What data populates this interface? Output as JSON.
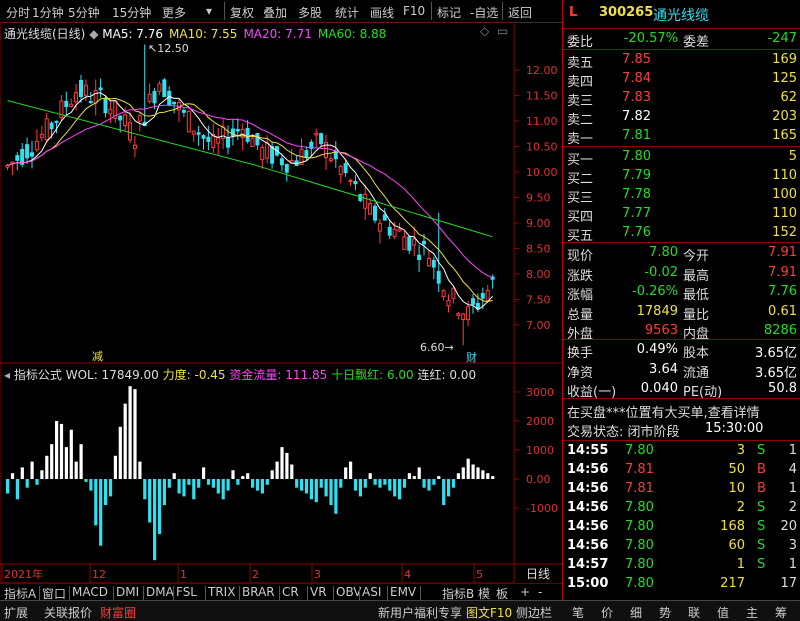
{
  "toolbar": {
    "items": [
      "分时",
      "1分钟",
      "5分钟",
      "15分钟",
      "更多",
      "复权",
      "叠加",
      "多股",
      "统计",
      "画线",
      "F10",
      "标记",
      "-自选",
      "返回"
    ]
  },
  "chart": {
    "title": "通光线缆(日线)",
    "ma": [
      {
        "label": "MA5: 7.76",
        "color": "#ffffff"
      },
      {
        "label": "MA10: 7.55",
        "color": "#f0e040"
      },
      {
        "label": "MA20: 7.71",
        "color": "#ff44ff"
      },
      {
        "label": "MA60: 8.88",
        "color": "#22dd22"
      }
    ],
    "price_ticks": [
      "12.00",
      "11.50",
      "11.00",
      "10.50",
      "10.00",
      "9.50",
      "9.00",
      "8.50",
      "8.00",
      "7.50",
      "7.00"
    ],
    "high_label": "12.50",
    "low_label": "6.60",
    "marker_jian": "减",
    "marker_cai": "财",
    "indicator": {
      "name": "指标公式",
      "wol": "WOL: 17849.00",
      "lidu": "力度: -0.45",
      "zjll": "资金流量: 111.85",
      "sr": "十日飘红: 6.00",
      "lh": "连红: 0.00"
    },
    "vol_ticks": [
      "3000",
      "2000",
      "1000",
      "0.00",
      "-1000"
    ],
    "date_labels": [
      "2021年",
      "12",
      "1",
      "2",
      "3",
      "4",
      "5"
    ],
    "period_label": "日线"
  },
  "bottom_tabs": [
    "指标A",
    "窗口",
    "MACD",
    "DMI",
    "DMA",
    "FSL",
    "TRIX",
    "BRAR",
    "CR",
    "VR",
    "OBV",
    "ASI",
    "EMV"
  ],
  "bottom_right_tabs": [
    "指标B",
    "模",
    "板"
  ],
  "status_left": [
    "扩展",
    "关联报价",
    "财富圈"
  ],
  "status_mid": [
    "新用户福利专享",
    "图文F10",
    "侧边栏"
  ],
  "status_right": [
    "笔",
    "价",
    "细",
    "势",
    "联",
    "值",
    "主",
    "筹"
  ],
  "panel": {
    "flag": "L",
    "code": "300265",
    "name": "通光线缆",
    "weibi_label": "委比",
    "weibi": "-20.57%",
    "weicha_label": "委差",
    "weicha": "-247",
    "asks": [
      {
        "label": "卖五",
        "price": "7.85",
        "vol": "169"
      },
      {
        "label": "卖四",
        "price": "7.84",
        "vol": "125"
      },
      {
        "label": "卖三",
        "price": "7.83",
        "vol": "62"
      },
      {
        "label": "卖二",
        "price": "7.82",
        "vol": "203"
      },
      {
        "label": "卖一",
        "price": "7.81",
        "vol": "165"
      }
    ],
    "bids": [
      {
        "label": "买一",
        "price": "7.80",
        "vol": "5"
      },
      {
        "label": "买二",
        "price": "7.79",
        "vol": "110"
      },
      {
        "label": "买三",
        "price": "7.78",
        "vol": "100"
      },
      {
        "label": "买四",
        "price": "7.77",
        "vol": "110"
      },
      {
        "label": "买五",
        "price": "7.76",
        "vol": "152"
      }
    ],
    "quote": [
      {
        "l1": "现价",
        "v1": "7.80",
        "l2": "今开",
        "v2": "7.91"
      },
      {
        "l1": "涨跌",
        "v1": "-0.02",
        "l2": "最高",
        "v2": "7.91"
      },
      {
        "l1": "涨幅",
        "v1": "-0.26%",
        "l2": "最低",
        "v2": "7.76"
      },
      {
        "l1": "总量",
        "v1": "17849",
        "l2": "量比",
        "v2": "0.61"
      },
      {
        "l1": "外盘",
        "v1": "9563",
        "l2": "内盘",
        "v2": "8286"
      }
    ],
    "fin": [
      {
        "l1": "换手",
        "v1": "0.49%",
        "l2": "股本",
        "v2": "3.65亿"
      },
      {
        "l1": "净资",
        "v1": "3.64",
        "l2": "流通",
        "v2": "3.65亿"
      },
      {
        "l1": "收益(一)",
        "v1": "0.040",
        "l2": "PE(动)",
        "v2": "50.8"
      }
    ],
    "notice": "在买盘***位置有大买单,查看详情",
    "trade_status": "交易状态: 闭市阶段",
    "trade_time": "15:30:00",
    "ticks": [
      {
        "t": "14:55",
        "p": "7.80",
        "v": "3",
        "s": "S",
        "n": "1"
      },
      {
        "t": "14:56",
        "p": "7.81",
        "v": "50",
        "s": "B",
        "n": "4"
      },
      {
        "t": "14:56",
        "p": "7.81",
        "v": "10",
        "s": "B",
        "n": "1"
      },
      {
        "t": "14:56",
        "p": "7.80",
        "v": "2",
        "s": "S",
        "n": "2"
      },
      {
        "t": "14:56",
        "p": "7.80",
        "v": "168",
        "s": "S",
        "n": "20"
      },
      {
        "t": "14:56",
        "p": "7.80",
        "v": "60",
        "s": "S",
        "n": "3"
      },
      {
        "t": "14:57",
        "p": "7.80",
        "v": "1",
        "s": "S",
        "n": "1"
      },
      {
        "t": "15:00",
        "p": "7.80",
        "v": "217",
        "s": "",
        "n": "17"
      }
    ]
  }
}
